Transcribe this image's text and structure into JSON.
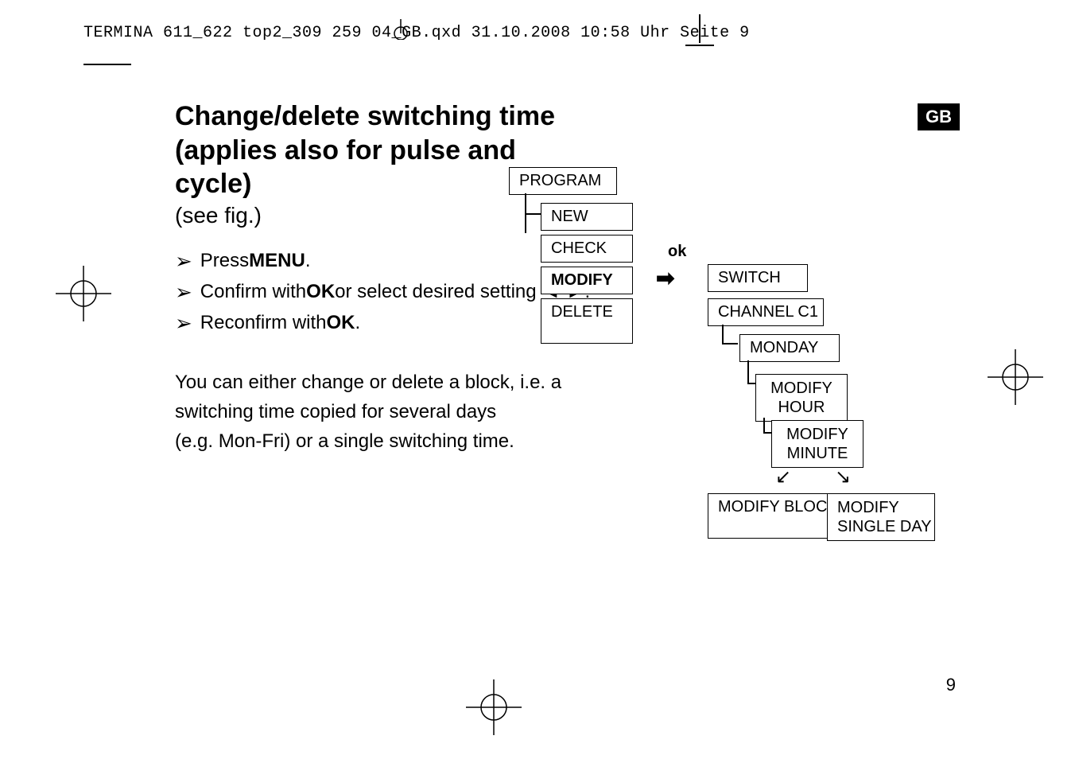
{
  "header": {
    "line": "TERMINA 611_622 top2_309 259 04_GB.qxd  31.10.2008  10:58 Uhr  Seite 9"
  },
  "badge": "GB",
  "page_number": "9",
  "title": {
    "l1": "Change/delete switching time",
    "l2": "(applies also for pulse and",
    "l3": "cycle)"
  },
  "note": "(see fig.)",
  "bullets": [
    {
      "pre": "Press ",
      "bold": "MENU",
      "post": "."
    },
    {
      "pre": "Confirm with ",
      "bold": "OK",
      "post": " or select desired setting ◄  ►."
    },
    {
      "pre": "Reconfirm with ",
      "bold": "OK",
      "post": " ."
    }
  ],
  "paragraph": {
    "l1": "You can either change or delete a block, i.e. a",
    "l2": "switching time copied for several days",
    "l3": "(e.g. Mon-Fri) or a single switching time."
  },
  "diagram": {
    "program": "PROGRAM",
    "new": "NEW",
    "check": "CHECK",
    "modify": "MODIFY",
    "delete": "DELETE",
    "ok": "ok",
    "switch": "SWITCH",
    "channel": "CHANNEL C1",
    "monday": "MONDAY",
    "modify_hour_l1": "MODIFY",
    "modify_hour_l2": "HOUR",
    "modify_min_l1": "MODIFY",
    "modify_min_l2": "MINUTE",
    "split_left": "↙",
    "split_right": "↘",
    "modify_block": "MODIFY BLOCK",
    "modify_single_l1": "MODIFY",
    "modify_single_l2": "SINGLE DAY"
  }
}
